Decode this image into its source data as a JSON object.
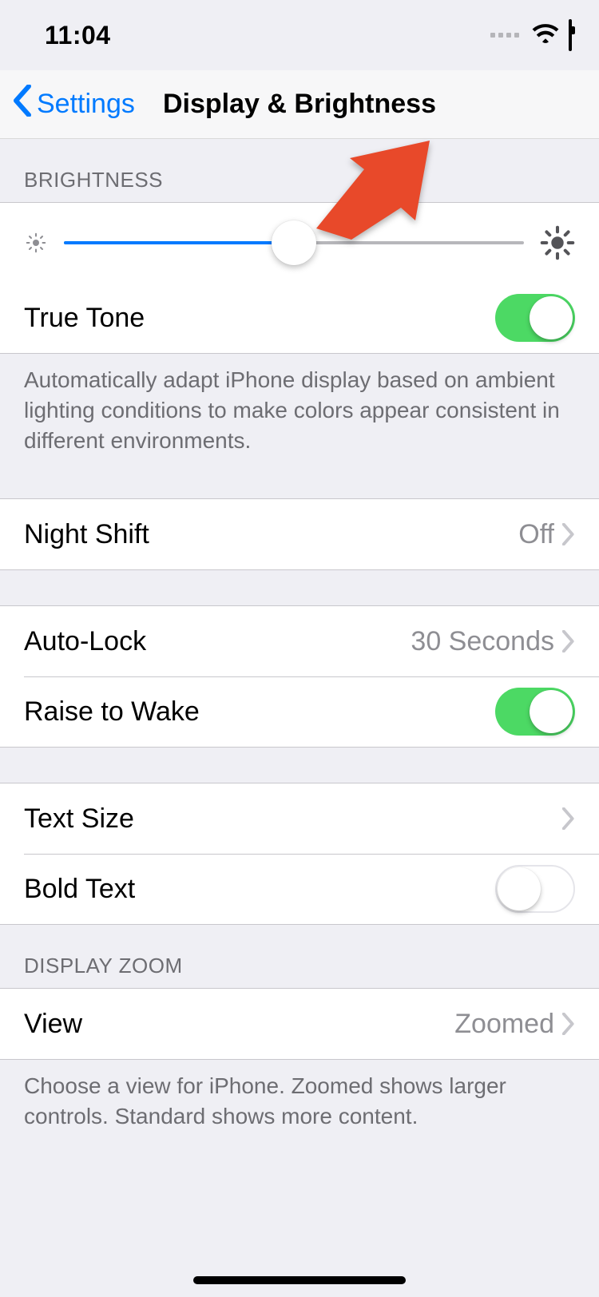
{
  "status": {
    "time": "11:04"
  },
  "nav": {
    "back_label": "Settings",
    "title": "Display & Brightness"
  },
  "brightness": {
    "header": "Brightness",
    "slider_percent": 50,
    "true_tone_label": "True Tone",
    "true_tone_on": true,
    "footer": "Automatically adapt iPhone display based on ambient lighting conditions to make colors appear consistent in different environments."
  },
  "night_shift": {
    "label": "Night Shift",
    "value": "Off"
  },
  "lock": {
    "auto_lock_label": "Auto-Lock",
    "auto_lock_value": "30 Seconds",
    "raise_to_wake_label": "Raise to Wake",
    "raise_to_wake_on": true
  },
  "text": {
    "text_size_label": "Text Size",
    "bold_text_label": "Bold Text",
    "bold_text_on": false
  },
  "zoom": {
    "header": "Display Zoom",
    "view_label": "View",
    "view_value": "Zoomed",
    "footer": "Choose a view for iPhone. Zoomed shows larger controls. Standard shows more content."
  },
  "annotation": {
    "arrow_color": "#e8492a"
  }
}
